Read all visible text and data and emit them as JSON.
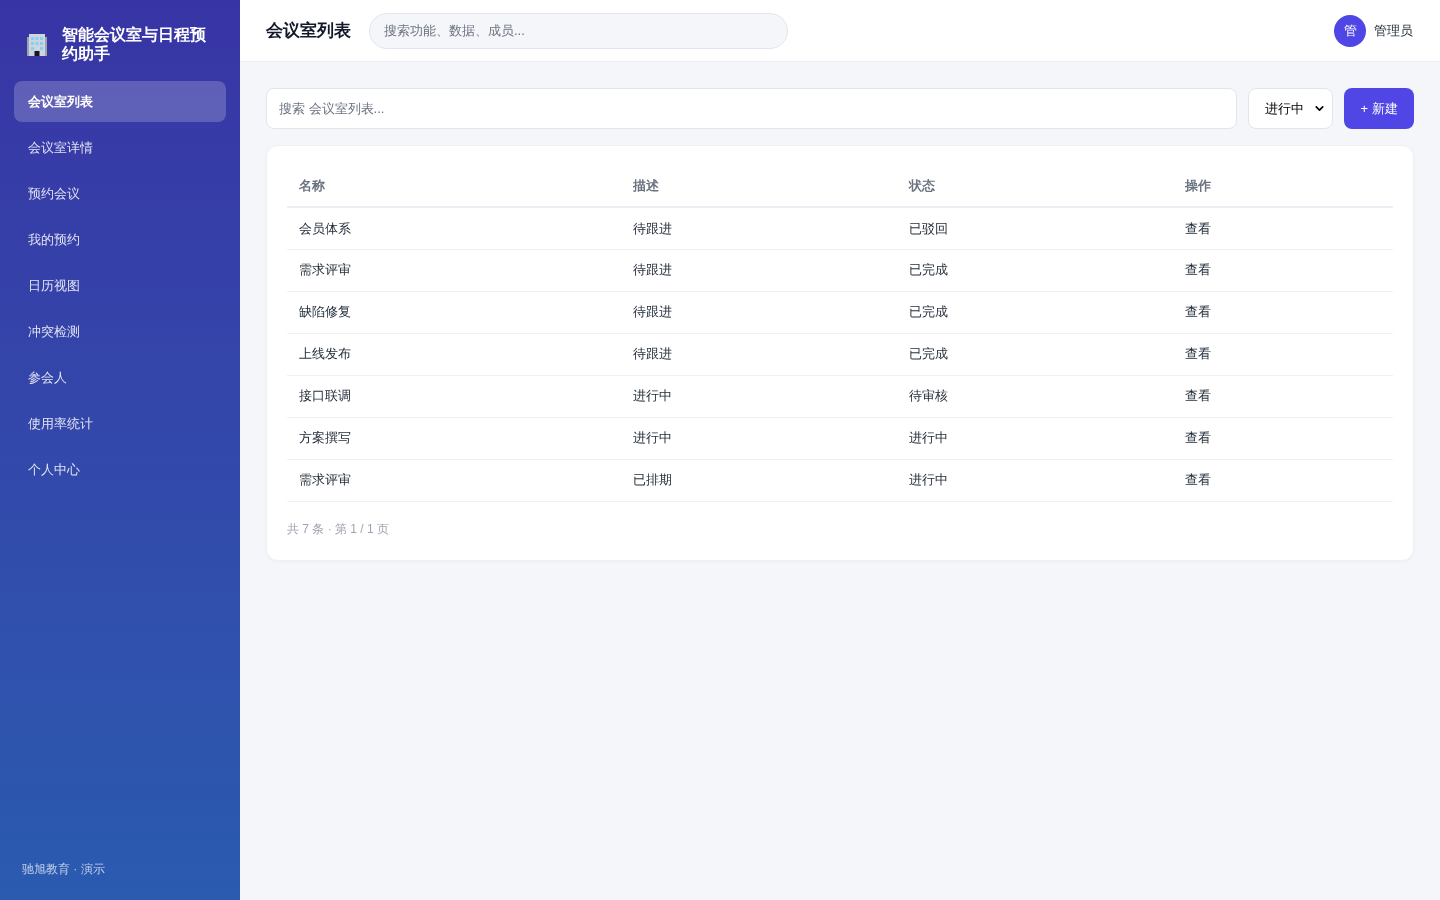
{
  "sidebar": {
    "logo_title": "智能会议室与日程预约助手",
    "items": [
      {
        "label": "会议室列表",
        "selected": true
      },
      {
        "label": "会议室详情",
        "selected": false
      },
      {
        "label": "预约会议",
        "selected": false
      },
      {
        "label": "我的预约",
        "selected": false
      },
      {
        "label": "日历视图",
        "selected": false
      },
      {
        "label": "冲突检测",
        "selected": false
      },
      {
        "label": "参会人",
        "selected": false
      },
      {
        "label": "使用率统计",
        "selected": false
      },
      {
        "label": "个人中心",
        "selected": false
      }
    ],
    "footer": "驰旭教育 · 演示"
  },
  "header": {
    "title": "会议室列表",
    "search": {
      "placeholder": "搜索功能、数据、成员..."
    },
    "user": {
      "avatar": "管",
      "name": "管理员"
    }
  },
  "toolbar": {
    "search": {
      "placeholder": "搜索 会议室列表..."
    },
    "filter": {
      "value": "进行中"
    },
    "new_button": "+ 新建"
  },
  "table": {
    "columns": [
      "名称",
      "描述",
      "状态",
      "操作"
    ],
    "rows": [
      {
        "name": "会员体系",
        "description": "待跟进",
        "status": "已驳回",
        "action": "查看"
      },
      {
        "name": "需求评审",
        "description": "待跟进",
        "status": "已完成",
        "action": "查看"
      },
      {
        "name": "缺陷修复",
        "description": "待跟进",
        "status": "已完成",
        "action": "查看"
      },
      {
        "name": "上线发布",
        "description": "待跟进",
        "status": "已完成",
        "action": "查看"
      },
      {
        "name": "接口联调",
        "description": "进行中",
        "status": "待审核",
        "action": "查看"
      },
      {
        "name": "方案撰写",
        "description": "进行中",
        "status": "进行中",
        "action": "查看"
      },
      {
        "name": "需求评审",
        "description": "已排期",
        "status": "进行中",
        "action": "查看"
      }
    ],
    "pagination": "共 7 条 · 第 1 / 1 页"
  }
}
